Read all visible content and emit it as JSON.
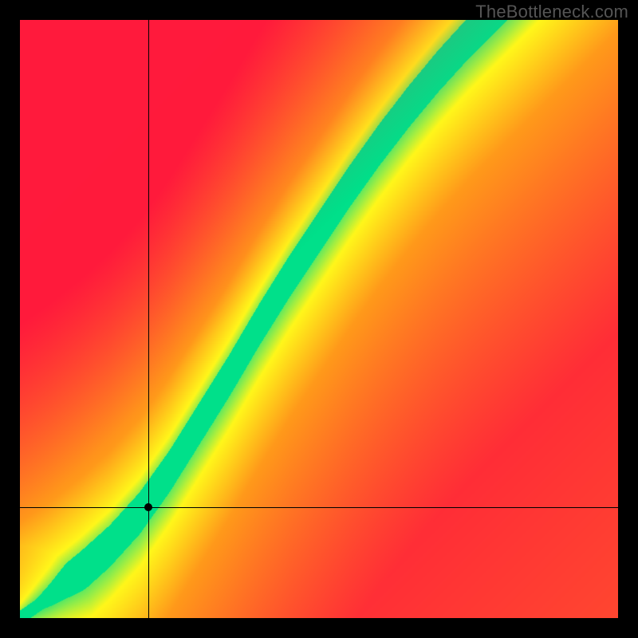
{
  "watermark": "TheBottleneck.com",
  "chart_data": {
    "type": "heatmap",
    "title": "",
    "xlabel": "",
    "ylabel": "",
    "xlim": [
      0,
      1
    ],
    "ylim": [
      0,
      1
    ],
    "grid": false,
    "legend": false,
    "colors": {
      "red": "#ff1a3c",
      "orange": "#ff9a1a",
      "yellow": "#fff71a",
      "green": "#00e08a"
    },
    "optimal_curve": [
      {
        "x": 0.0,
        "y": 0.0
      },
      {
        "x": 0.05,
        "y": 0.035
      },
      {
        "x": 0.1,
        "y": 0.075
      },
      {
        "x": 0.15,
        "y": 0.12
      },
      {
        "x": 0.2,
        "y": 0.175
      },
      {
        "x": 0.25,
        "y": 0.245
      },
      {
        "x": 0.3,
        "y": 0.325
      },
      {
        "x": 0.35,
        "y": 0.405
      },
      {
        "x": 0.4,
        "y": 0.49
      },
      {
        "x": 0.45,
        "y": 0.57
      },
      {
        "x": 0.5,
        "y": 0.645
      },
      {
        "x": 0.55,
        "y": 0.72
      },
      {
        "x": 0.6,
        "y": 0.79
      },
      {
        "x": 0.65,
        "y": 0.855
      },
      {
        "x": 0.7,
        "y": 0.915
      },
      {
        "x": 0.75,
        "y": 0.97
      },
      {
        "x": 0.8,
        "y": 1.02
      }
    ],
    "crosshair": {
      "x": 0.215,
      "y": 0.185
    },
    "marker": {
      "x": 0.215,
      "y": 0.185
    },
    "band_width_green": 0.035,
    "band_width_yellow": 0.095,
    "fade_radius": 0.55
  }
}
